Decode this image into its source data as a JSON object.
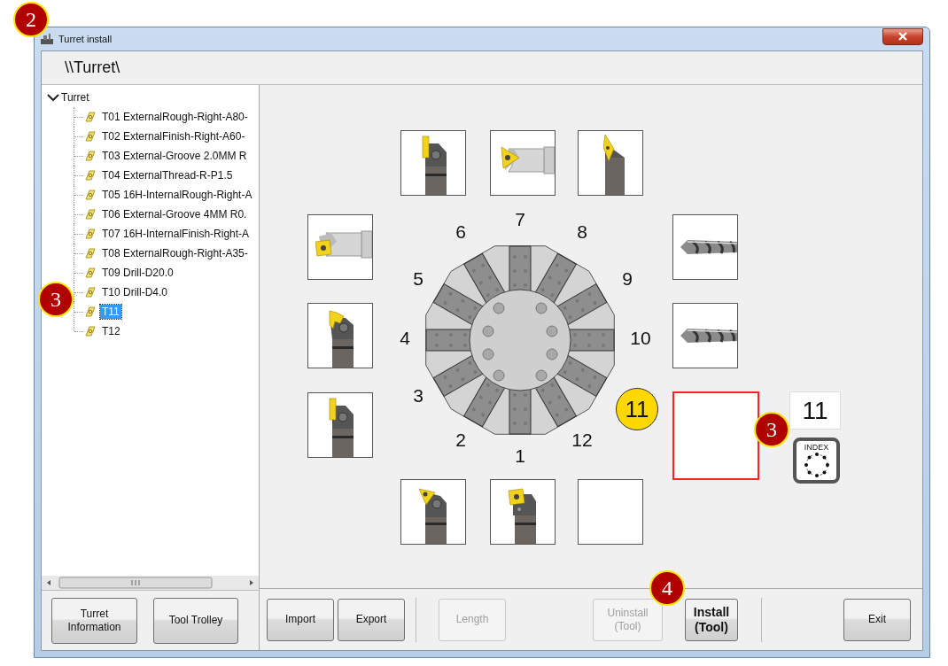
{
  "window": {
    "title": "Turret install"
  },
  "path": "\\\\Turret\\",
  "tree": {
    "label": "Turret",
    "expanded": true,
    "children": [
      {
        "label": "T01 ExternalRough-Right-A80-",
        "selected": false
      },
      {
        "label": "T02 ExternalFinish-Right-A60-",
        "selected": false
      },
      {
        "label": "T03 External-Groove 2.0MM R",
        "selected": false
      },
      {
        "label": "T04 ExternalThread-R-P1.5",
        "selected": false
      },
      {
        "label": "T05 16H-InternalRough-Right-A",
        "selected": false
      },
      {
        "label": "T06 External-Groove 4MM R0.",
        "selected": false
      },
      {
        "label": "T07 16H-InternalFinish-Right-A",
        "selected": false
      },
      {
        "label": "T08 ExternalRough-Right-A35-",
        "selected": false
      },
      {
        "label": "T09 Drill-D20.0",
        "selected": false
      },
      {
        "label": "T10 Drill-D4.0",
        "selected": false
      },
      {
        "label": "T11",
        "selected": true
      },
      {
        "label": "T12",
        "selected": false
      }
    ]
  },
  "left_buttons": [
    {
      "label": "Turret Information",
      "disabled": false
    },
    {
      "label": "Tool Trolley",
      "disabled": false
    }
  ],
  "slots": [
    {
      "number": "1",
      "kind": "square",
      "selected": false
    },
    {
      "number": "2",
      "kind": "triangle",
      "selected": false
    },
    {
      "number": "3",
      "kind": "groove",
      "selected": false
    },
    {
      "number": "4",
      "kind": "profile",
      "selected": false
    },
    {
      "number": "5",
      "kind": "boring",
      "selected": false
    },
    {
      "number": "6",
      "kind": "groove",
      "selected": false
    },
    {
      "number": "7",
      "kind": "boring2",
      "selected": false
    },
    {
      "number": "8",
      "kind": "diamond",
      "selected": false
    },
    {
      "number": "9",
      "kind": "drill",
      "selected": false
    },
    {
      "number": "10",
      "kind": "drill",
      "selected": false
    },
    {
      "number": "11",
      "kind": "empty",
      "selected": true
    },
    {
      "number": "12",
      "kind": "empty",
      "selected": false
    }
  ],
  "current_station": "11",
  "index_button": {
    "label": "INDEX"
  },
  "bottom_buttons": [
    {
      "label": "Import",
      "disabled": false,
      "default": false
    },
    {
      "label": "Export",
      "disabled": false,
      "default": false
    },
    {
      "label": "Length",
      "disabled": true,
      "default": false
    },
    {
      "label": "Uninstall (Tool)",
      "disabled": true,
      "default": false
    },
    {
      "label": "Install (Tool)",
      "disabled": false,
      "default": true
    },
    {
      "label": "Exit",
      "disabled": false,
      "default": false
    }
  ],
  "callouts": [
    {
      "label": "2"
    },
    {
      "label": "3"
    },
    {
      "label": "3"
    },
    {
      "label": "4"
    }
  ]
}
